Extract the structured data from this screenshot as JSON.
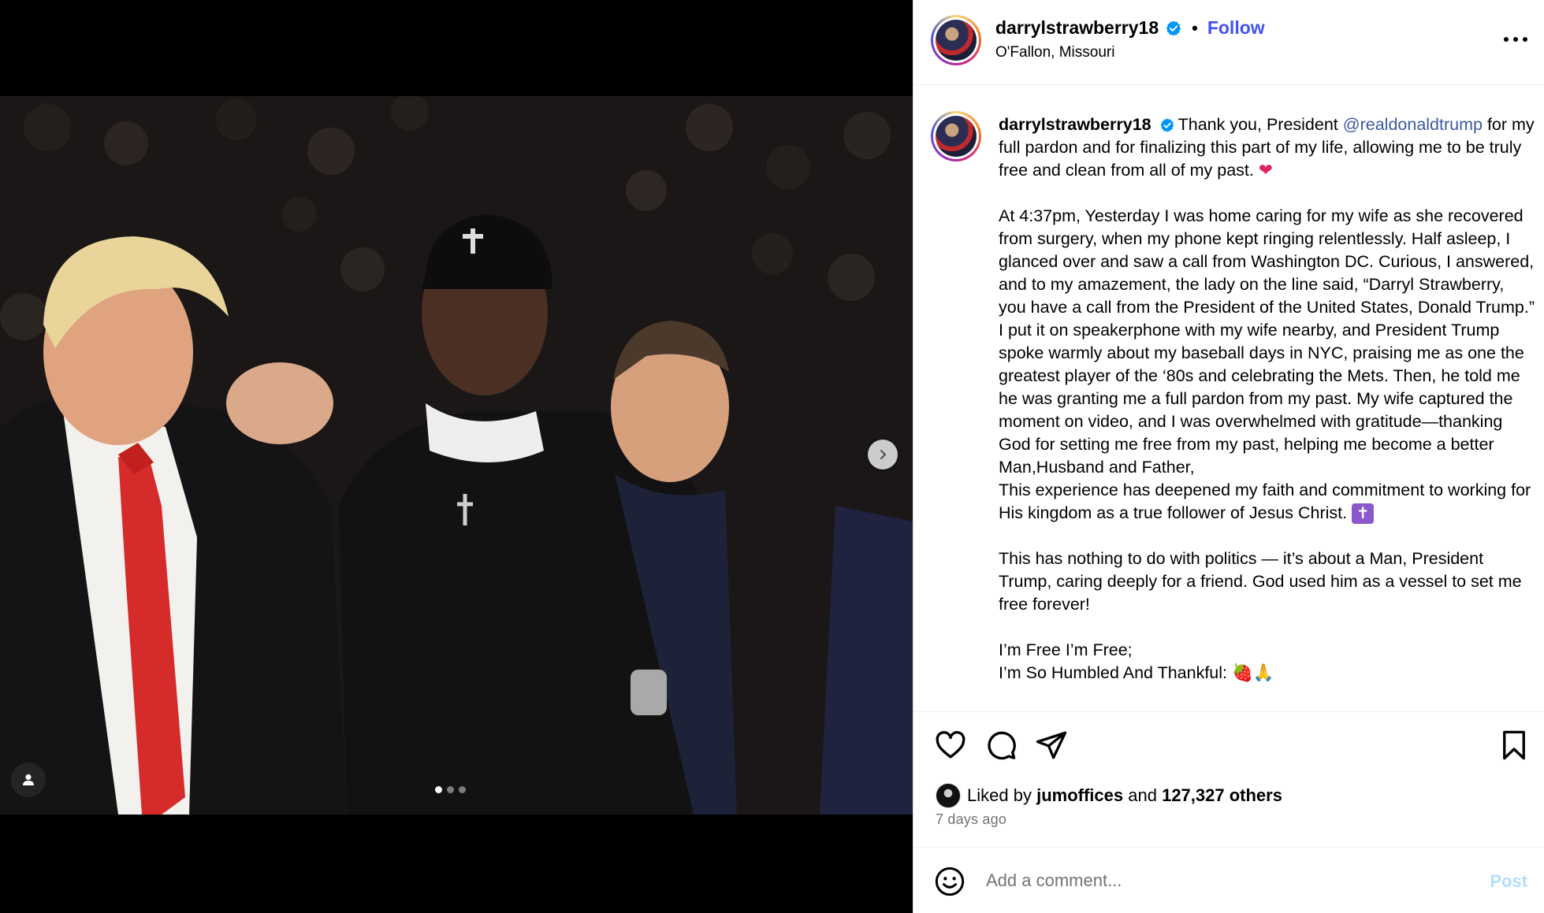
{
  "post": {
    "username": "darrylstrawberry18",
    "follow_label": "Follow",
    "separator": "•",
    "location": "O'Fallon, Missouri"
  },
  "caption": {
    "username": "darrylstrawberry18",
    "line1_pre": "Thank you, President ",
    "mention": "@realdonaldtrump",
    "line1_post": " for my full pardon and for finalizing this part of my life, allowing me to be truly free and clean from all of my past. ",
    "heart": "❤",
    "para2": "At 4:37pm, Yesterday I was home caring for my wife as she recovered from surgery, when my phone kept ringing relentlessly. Half asleep, I glanced over and saw a call from Washington DC. Curious, I answered, and to my amazement, the lady on the line said, “Darryl Strawberry, you have a call from the President of the United States, Donald Trump.” I put it on speakerphone with my wife nearby, and President Trump spoke warmly about my baseball days in NYC, praising me as one the greatest player of the ‘80s and celebrating the Mets. Then, he told me he was granting me a full pardon from my past. My wife captured the moment on video, and I was overwhelmed with gratitude—thanking God for setting me free from my past, helping me become a better Man,Husband and Father,",
    "para2b": "This experience has deepened my faith and commitment to working for His kingdom as a true follower of Jesus Christ. ",
    "cross": "✝",
    "para3": "This has nothing to do with politics — it’s about a Man, President Trump, caring deeply for a friend. God used him as a vessel to set me free forever!",
    "para4a": "I’m Free I’m Free;",
    "para4b": "I’m So Humbled And Thankful: 🍓🙏"
  },
  "likes": {
    "prefix": "Liked by",
    "user": "jumoffices",
    "middle": "and",
    "count": "127,327 others"
  },
  "time_ago": "7 days ago",
  "comment": {
    "placeholder": "Add a comment...",
    "post_label": "Post"
  },
  "media": {
    "carousel_pages": 3,
    "active_page": 1
  },
  "colors": {
    "accent": "#4150f7",
    "mention": "#3b5aa3",
    "verified": "#0095f6",
    "post_disabled": "#b2dffc",
    "muted": "#737373"
  }
}
